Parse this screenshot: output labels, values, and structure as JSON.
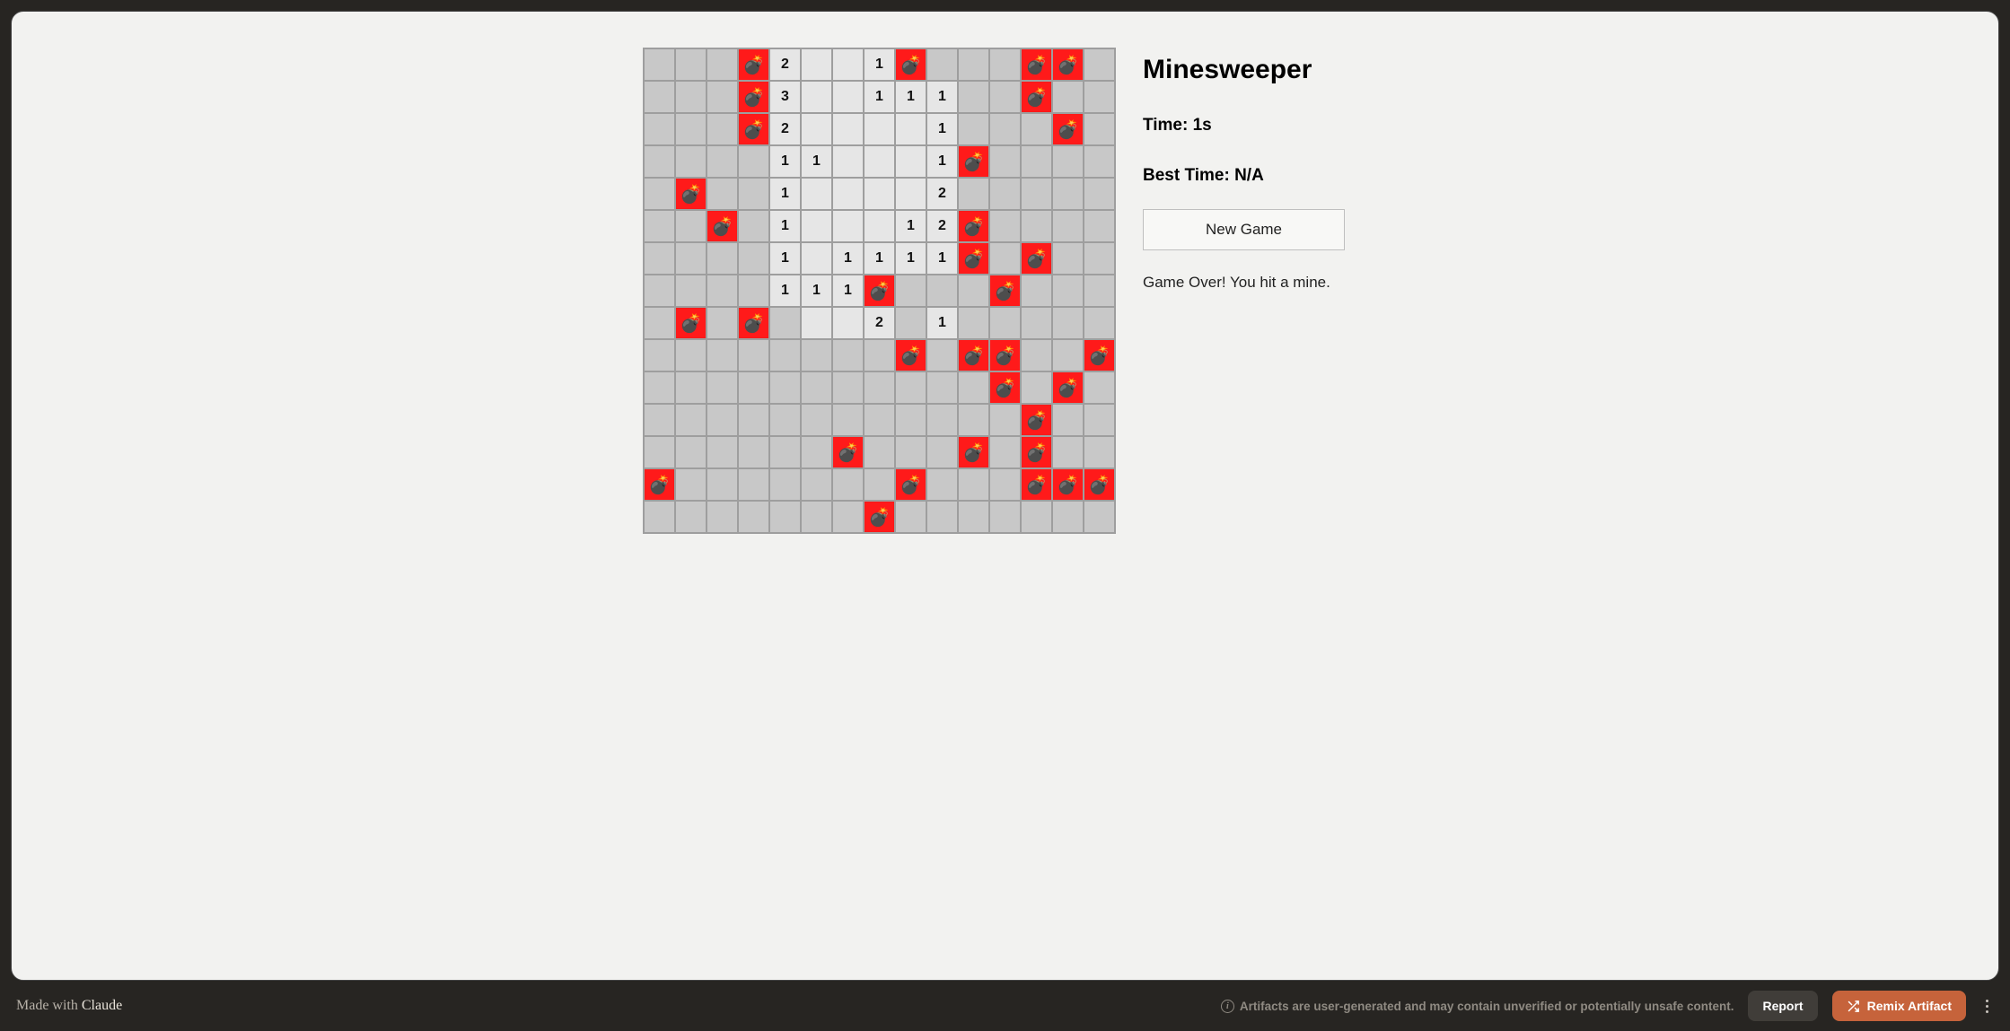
{
  "game": {
    "title": "Minesweeper",
    "time_label": "Time: ",
    "time_value": "1s",
    "best_label": "Best Time: ",
    "best_value": "N/A",
    "new_game": "New Game",
    "status": "Game Over! You hit a mine.",
    "cols": 15,
    "rows": 15,
    "bomb_glyph": "💣",
    "grid": [
      [
        "h",
        "h",
        "h",
        "M",
        "2r",
        "r",
        "r",
        "1r",
        "M",
        "h",
        "h",
        "h",
        "M",
        "M",
        "h"
      ],
      [
        "h",
        "h",
        "h",
        "M",
        "3r",
        "r",
        "r",
        "1r",
        "1r",
        "1r",
        "h",
        "h",
        "M",
        "h",
        "h"
      ],
      [
        "h",
        "h",
        "h",
        "M",
        "2r",
        "r",
        "r",
        "r",
        "r",
        "1r",
        "h",
        "h",
        "h",
        "M",
        "h"
      ],
      [
        "h",
        "h",
        "h",
        "h",
        "1r",
        "1r",
        "r",
        "r",
        "r",
        "1r",
        "M",
        "h",
        "h",
        "h",
        "h"
      ],
      [
        "h",
        "M",
        "h",
        "h",
        "1r",
        "r",
        "r",
        "r",
        "r",
        "2r",
        "h",
        "h",
        "h",
        "h",
        "h"
      ],
      [
        "h",
        "h",
        "M",
        "h",
        "1r",
        "r",
        "r",
        "r",
        "1r",
        "2r",
        "M",
        "h",
        "h",
        "h",
        "h"
      ],
      [
        "h",
        "h",
        "h",
        "h",
        "1r",
        "r",
        "1r",
        "1r",
        "1r",
        "1r",
        "M",
        "h",
        "M",
        "h",
        "h"
      ],
      [
        "h",
        "h",
        "h",
        "h",
        "1r",
        "1r",
        "1r",
        "M",
        "h",
        "h",
        "h",
        "M",
        "h",
        "h",
        "h"
      ],
      [
        "h",
        "M",
        "h",
        "M",
        "h",
        "r",
        "r",
        "2r",
        "h",
        "1r",
        "h",
        "h",
        "h",
        "h",
        "h"
      ],
      [
        "h",
        "h",
        "h",
        "h",
        "h",
        "h",
        "h",
        "h",
        "M",
        "h",
        "M",
        "M",
        "h",
        "h",
        "M"
      ],
      [
        "h",
        "h",
        "h",
        "h",
        "h",
        "h",
        "h",
        "h",
        "h",
        "h",
        "h",
        "M",
        "h",
        "M",
        "h"
      ],
      [
        "h",
        "h",
        "h",
        "h",
        "h",
        "h",
        "h",
        "h",
        "h",
        "h",
        "h",
        "h",
        "M",
        "h",
        "h"
      ],
      [
        "h",
        "h",
        "h",
        "h",
        "h",
        "h",
        "M",
        "h",
        "h",
        "h",
        "M",
        "h",
        "M",
        "h",
        "h"
      ],
      [
        "M",
        "h",
        "h",
        "h",
        "h",
        "h",
        "h",
        "h",
        "M",
        "h",
        "h",
        "h",
        "M",
        "M",
        "M"
      ],
      [
        "h",
        "h",
        "h",
        "h",
        "h",
        "h",
        "h",
        "M",
        "h",
        "h",
        "h",
        "h",
        "h",
        "h",
        "h"
      ]
    ]
  },
  "footer": {
    "made_with_prefix": "Made with ",
    "made_with_brand": "Claude",
    "disclaimer": "Artifacts are user-generated and may contain unverified or potentially unsafe content.",
    "report": "Report",
    "remix": "Remix Artifact"
  }
}
